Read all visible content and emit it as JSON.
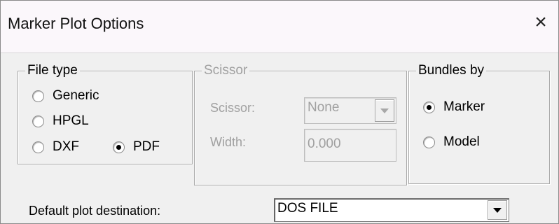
{
  "window": {
    "title": "Marker Plot Options",
    "close_symbol": "×"
  },
  "file_type": {
    "legend": "File type",
    "options": [
      "Generic",
      "HPGL",
      "DXF",
      "PDF"
    ],
    "selected": "PDF"
  },
  "scissor": {
    "legend": "Scissor",
    "scissor_label": "Scissor:",
    "scissor_value": "None",
    "width_label": "Width:",
    "width_value": "0.000",
    "enabled": false
  },
  "bundles_by": {
    "legend": "Bundles by",
    "options": [
      "Marker",
      "Model"
    ],
    "selected": "Marker"
  },
  "destination": {
    "label": "Default plot destination:",
    "value": "DOS FILE"
  }
}
